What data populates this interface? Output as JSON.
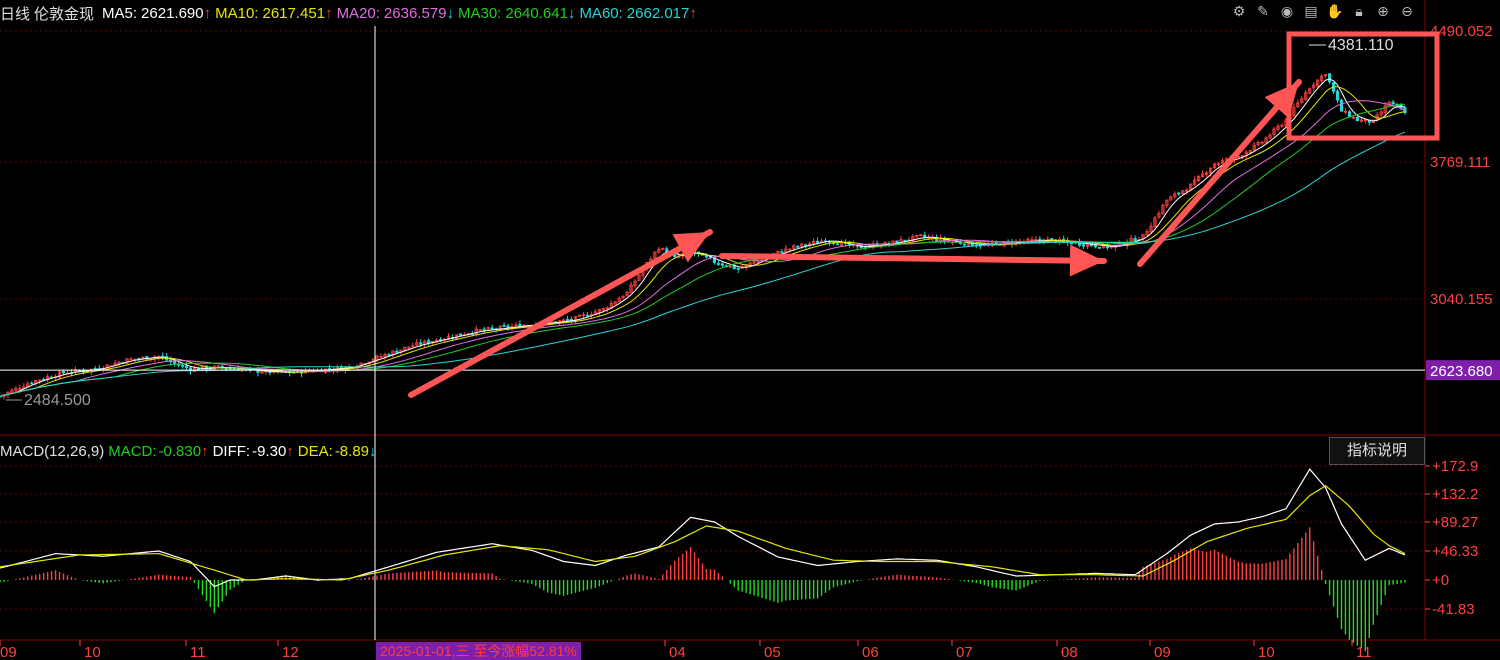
{
  "header": {
    "period": "日线",
    "symbol": "伦敦金现",
    "ma": [
      {
        "label": "MA5:",
        "value": "2621.690",
        "arrow": "↑",
        "color": "#ffffff",
        "arrow_color": "#ff3b3b"
      },
      {
        "label": "MA10:",
        "value": "2617.451",
        "arrow": "↑",
        "color": "#e6e600",
        "arrow_color": "#ff3b3b"
      },
      {
        "label": "MA20:",
        "value": "2636.579",
        "arrow": "↓",
        "color": "#e070e0",
        "arrow_color": "#2ad4d4"
      },
      {
        "label": "MA30:",
        "value": "2640.641",
        "arrow": "↓",
        "color": "#22cc22",
        "arrow_color": "#2ad4d4"
      },
      {
        "label": "MA60:",
        "value": "2662.017",
        "arrow": "↑",
        "color": "#2ad4d4",
        "arrow_color": "#ff3b3b"
      }
    ]
  },
  "toolbar": {
    "icons": [
      "settings-icon",
      "pen-icon",
      "eye-icon",
      "toolbox-icon",
      "hand-icon",
      "lock-icon",
      "zoom-in-icon",
      "zoom-out-icon"
    ]
  },
  "macd_header": {
    "title": "MACD(12,26,9)",
    "macd_label": "MACD:",
    "macd_value": "-0.830",
    "macd_arrow": "↑",
    "diff_label": "DIFF:",
    "diff_value": "-9.30",
    "diff_arrow": "↑",
    "dea_label": "DEA:",
    "dea_value": "-8.89",
    "dea_arrow": "↓"
  },
  "indicator_button": "指标说明",
  "date_tag": "2025-01-01,三  至今涨幅52.81%",
  "colors": {
    "up": "#ff4040",
    "down": "#22d8d8",
    "grid": "#6b0000",
    "axis_text": "#ff4040",
    "annotation": "#ff5555",
    "crosshair": "#ffffff"
  },
  "chart_data": [
    {
      "type": "candlestick",
      "title": "伦敦金现 日线",
      "x_ticks": [
        "09",
        "10",
        "11",
        "12",
        "04",
        "05",
        "06",
        "07",
        "08",
        "09",
        "10",
        "11"
      ],
      "y_ticks": [
        "4490.052",
        "3769.111",
        "3040.155",
        "2623.680"
      ],
      "ylim": [
        2300,
        4490.052
      ],
      "price_marks": {
        "high_label": "4381.110",
        "low_label": "2484.500",
        "current": "2623.680"
      },
      "close_path": [
        [
          0,
          2480
        ],
        [
          8,
          2560
        ],
        [
          16,
          2610
        ],
        [
          24,
          2630
        ],
        [
          32,
          2680
        ],
        [
          40,
          2700
        ],
        [
          44,
          2660
        ],
        [
          48,
          2630
        ],
        [
          56,
          2640
        ],
        [
          64,
          2620
        ],
        [
          72,
          2610
        ],
        [
          80,
          2624
        ],
        [
          88,
          2640
        ],
        [
          96,
          2700
        ],
        [
          104,
          2760
        ],
        [
          112,
          2800
        ],
        [
          120,
          2840
        ],
        [
          128,
          2860
        ],
        [
          136,
          2880
        ],
        [
          144,
          2900
        ],
        [
          152,
          2960
        ],
        [
          158,
          3050
        ],
        [
          162,
          3180
        ],
        [
          166,
          3300
        ],
        [
          170,
          3240
        ],
        [
          174,
          3280
        ],
        [
          180,
          3220
        ],
        [
          186,
          3180
        ],
        [
          192,
          3240
        ],
        [
          200,
          3300
        ],
        [
          208,
          3340
        ],
        [
          216,
          3300
        ],
        [
          224,
          3320
        ],
        [
          232,
          3360
        ],
        [
          240,
          3330
        ],
        [
          248,
          3310
        ],
        [
          256,
          3330
        ],
        [
          264,
          3340
        ],
        [
          272,
          3320
        ],
        [
          280,
          3300
        ],
        [
          288,
          3360
        ],
        [
          294,
          3560
        ],
        [
          300,
          3640
        ],
        [
          306,
          3760
        ],
        [
          312,
          3800
        ],
        [
          318,
          3880
        ],
        [
          324,
          4000
        ],
        [
          330,
          4180
        ],
        [
          334,
          4260
        ],
        [
          338,
          4050
        ],
        [
          342,
          4000
        ],
        [
          346,
          3990
        ],
        [
          350,
          4100
        ],
        [
          354,
          4040
        ]
      ],
      "ma_series": [
        "MA5",
        "MA10",
        "MA20",
        "MA30",
        "MA60"
      ]
    },
    {
      "type": "macd",
      "title": "MACD(12,26,9)",
      "y_ticks": [
        "+172.9",
        "+132.2",
        "+89.27",
        "+46.33",
        "+0",
        "-41.83"
      ],
      "ylim": [
        -85,
        190
      ],
      "diff_path": [
        [
          0,
          18
        ],
        [
          14,
          40
        ],
        [
          26,
          36
        ],
        [
          40,
          44
        ],
        [
          48,
          28
        ],
        [
          54,
          -10
        ],
        [
          58,
          0
        ],
        [
          64,
          0
        ],
        [
          72,
          6
        ],
        [
          80,
          0
        ],
        [
          88,
          2
        ],
        [
          98,
          20
        ],
        [
          110,
          42
        ],
        [
          124,
          55
        ],
        [
          134,
          45
        ],
        [
          142,
          28
        ],
        [
          150,
          22
        ],
        [
          158,
          38
        ],
        [
          166,
          50
        ],
        [
          174,
          95
        ],
        [
          180,
          88
        ],
        [
          186,
          66
        ],
        [
          196,
          35
        ],
        [
          206,
          22
        ],
        [
          216,
          28
        ],
        [
          226,
          32
        ],
        [
          236,
          30
        ],
        [
          246,
          20
        ],
        [
          256,
          6
        ],
        [
          266,
          8
        ],
        [
          276,
          10
        ],
        [
          286,
          8
        ],
        [
          294,
          40
        ],
        [
          300,
          68
        ],
        [
          306,
          85
        ],
        [
          312,
          88
        ],
        [
          318,
          96
        ],
        [
          324,
          108
        ],
        [
          330,
          168
        ],
        [
          334,
          140
        ],
        [
          338,
          85
        ],
        [
          344,
          30
        ],
        [
          350,
          48
        ],
        [
          354,
          38
        ]
      ],
      "dea_path": [
        [
          0,
          20
        ],
        [
          20,
          38
        ],
        [
          40,
          40
        ],
        [
          54,
          15
        ],
        [
          62,
          0
        ],
        [
          72,
          2
        ],
        [
          86,
          0
        ],
        [
          98,
          15
        ],
        [
          112,
          38
        ],
        [
          126,
          52
        ],
        [
          138,
          46
        ],
        [
          150,
          28
        ],
        [
          160,
          36
        ],
        [
          170,
          58
        ],
        [
          178,
          82
        ],
        [
          186,
          74
        ],
        [
          198,
          48
        ],
        [
          210,
          30
        ],
        [
          222,
          28
        ],
        [
          236,
          28
        ],
        [
          250,
          20
        ],
        [
          262,
          8
        ],
        [
          276,
          8
        ],
        [
          288,
          6
        ],
        [
          296,
          30
        ],
        [
          304,
          58
        ],
        [
          314,
          78
        ],
        [
          324,
          92
        ],
        [
          330,
          128
        ],
        [
          334,
          143
        ],
        [
          340,
          112
        ],
        [
          346,
          70
        ],
        [
          350,
          52
        ],
        [
          354,
          40
        ]
      ]
    }
  ]
}
